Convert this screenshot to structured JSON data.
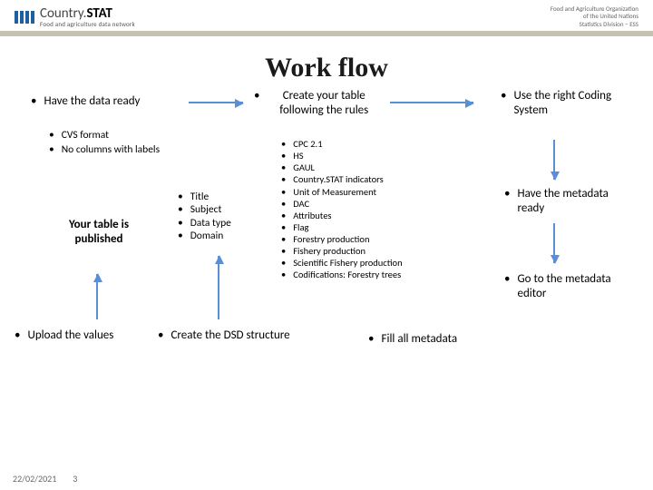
{
  "header": {
    "brand_main_a": "Country.",
    "brand_main_b": "STAT",
    "brand_sub": "Food and agriculture data network",
    "org_line1": "Food and Agriculture Organization",
    "org_line2": "of the United Nations",
    "org_line3": "Statistics Division – ESS"
  },
  "title": "Work flow",
  "steps": {
    "have_data": "Have the data ready",
    "create_table": "Create your table following the rules",
    "use_coding": "Use the right Coding System",
    "have_metadata": "Have the metadata ready",
    "goto_editor": "Go to the metadata editor",
    "fill_metadata": "Fill all metadata",
    "create_dsd": "Create the DSD structure",
    "upload_values": "Upload the values",
    "published": "Your table is published"
  },
  "data_ready_sub": {
    "a": "CVS format",
    "b": "No columns with labels"
  },
  "dsd_sub": {
    "a": "Title",
    "b": "Subject",
    "c": "Data type",
    "d": "Domain"
  },
  "coding_list": {
    "a": "CPC 2.1",
    "b": "HS",
    "c": "GAUL",
    "d": "Country.STAT indicators",
    "e": "Unit of Measurement",
    "f": "DAC",
    "g": "Attributes",
    "h": "Flag",
    "i": "Forestry production",
    "j": "Fishery production",
    "k": "Scientific Fishery production",
    "l": "Codifications: Forestry trees"
  },
  "footer": {
    "date": "22/02/2021",
    "page": "3"
  }
}
